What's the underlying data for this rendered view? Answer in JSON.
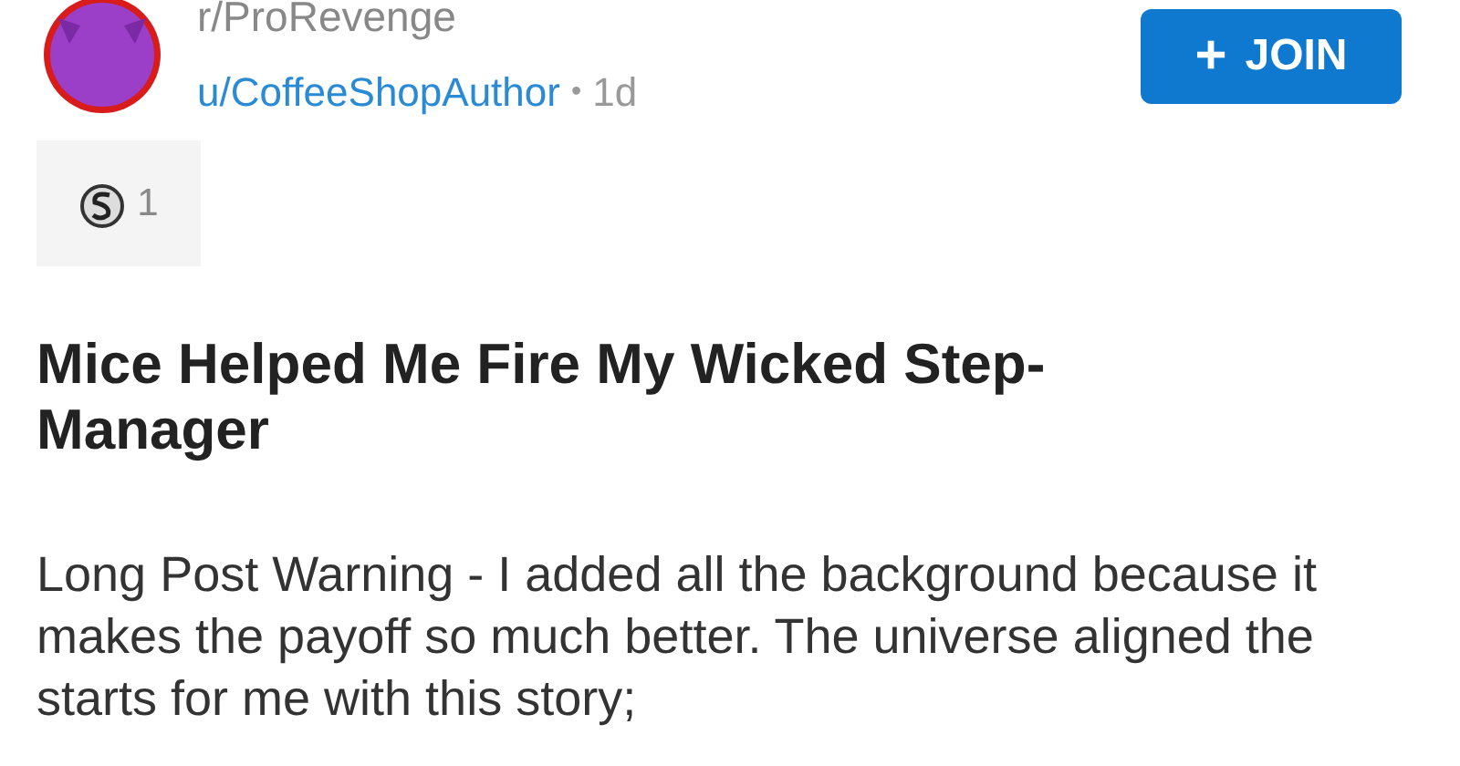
{
  "post": {
    "subreddit": "r/ProRevenge",
    "author": "u/CoffeeShopAuthor",
    "separator": "•",
    "age": "1d",
    "join_button": {
      "icon": "+",
      "label": "JOIN"
    },
    "award": {
      "count": "1"
    },
    "title": "Mice Helped Me Fire My Wicked Step-Manager",
    "body": "Long Post Warning - I added all the background because it makes the payoff so much better. The universe aligned the starts for me with this story;"
  }
}
